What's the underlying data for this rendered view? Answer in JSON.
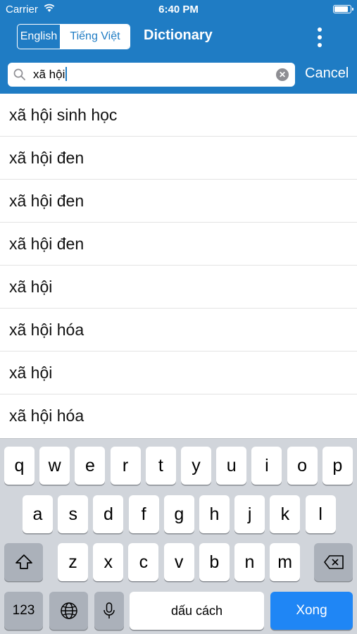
{
  "status": {
    "carrier": "Carrier",
    "time": "6:40 PM"
  },
  "nav": {
    "segments": [
      {
        "label": "English",
        "active": false
      },
      {
        "label": "Tiếng Việt",
        "active": true
      }
    ],
    "title": "Dictionary"
  },
  "search": {
    "value": "xã hội",
    "cancel_label": "Cancel"
  },
  "results": [
    "xã hội sinh học",
    "xã hội đen",
    "xã hội đen",
    "xã hội đen",
    "xã hội",
    "xã hội hóa",
    "xã hội",
    "xã hội hóa"
  ],
  "keyboard": {
    "row1": [
      "q",
      "w",
      "e",
      "r",
      "t",
      "y",
      "u",
      "i",
      "o",
      "p"
    ],
    "row2": [
      "a",
      "s",
      "d",
      "f",
      "g",
      "h",
      "j",
      "k",
      "l"
    ],
    "row3": [
      "z",
      "x",
      "c",
      "v",
      "b",
      "n",
      "m"
    ],
    "numbers_label": "123",
    "space_label": "dấu cách",
    "return_label": "Xong"
  },
  "colors": {
    "accent": "#1f7cc4",
    "keyboard_bg": "#d1d5db",
    "return_key": "#1f86f5"
  }
}
